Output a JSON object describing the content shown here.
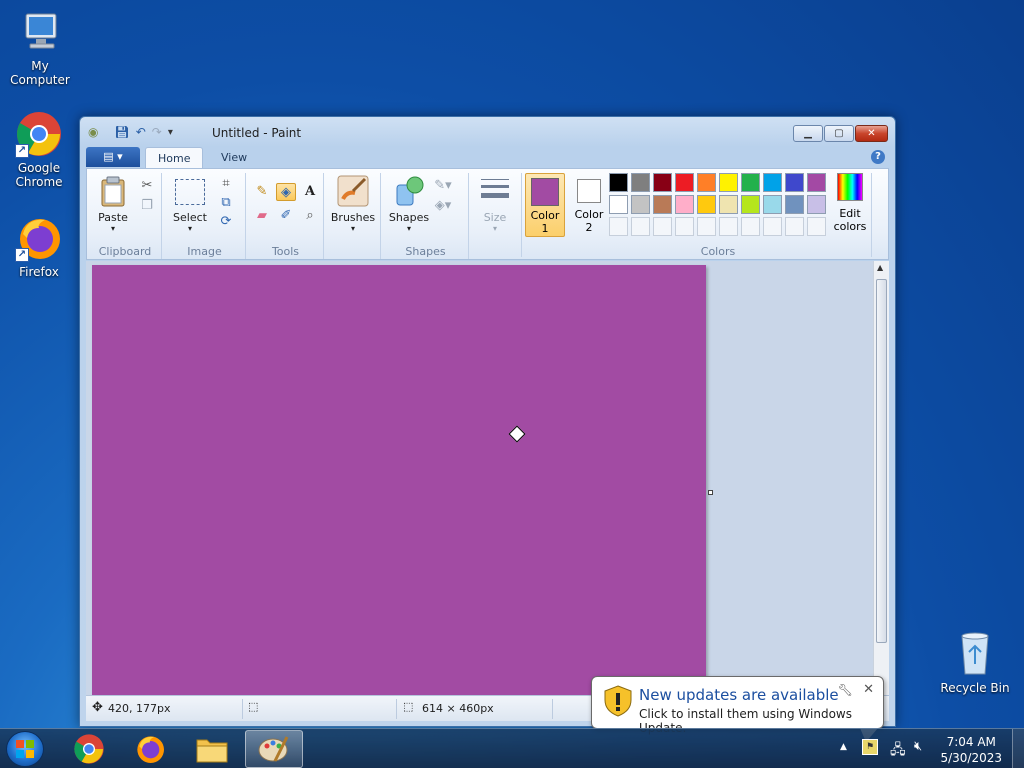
{
  "desktop": {
    "icons": [
      {
        "label": "My Computer",
        "icon": "computer-icon"
      },
      {
        "label": "Google\nChrome",
        "icon": "chrome-icon"
      },
      {
        "label": "Firefox",
        "icon": "firefox-icon"
      },
      {
        "label": "Recycle Bin",
        "icon": "recycle-bin-icon"
      }
    ],
    "chrome_label_1": "Google",
    "chrome_label_2": "Chrome"
  },
  "window": {
    "title": "Untitled - Paint",
    "tabs": {
      "home": "Home",
      "view": "View"
    },
    "help": "?"
  },
  "ribbon": {
    "clipboard": {
      "label": "Clipboard",
      "paste": "Paste"
    },
    "image": {
      "label": "Image",
      "select": "Select"
    },
    "tools": {
      "label": "Tools"
    },
    "brushes": "Brushes",
    "shapes": {
      "label": "Shapes",
      "shapes_btn": "Shapes"
    },
    "size": "Size",
    "color1": {
      "line1": "Color",
      "line2": "1",
      "value": "#a24ba3"
    },
    "color2": {
      "line1": "Color",
      "line2": "2",
      "value": "#ffffff"
    },
    "colors_label": "Colors",
    "edit_colors": {
      "line1": "Edit",
      "line2": "colors"
    },
    "palette_row1": [
      "#000000",
      "#7f7f7f",
      "#880015",
      "#ed1c24",
      "#ff7f27",
      "#fff200",
      "#22b14c",
      "#00a2e8",
      "#3f48cc",
      "#a349a4"
    ],
    "palette_row2": [
      "#ffffff",
      "#c3c3c3",
      "#b97a57",
      "#ffaec9",
      "#ffc90e",
      "#efe4b0",
      "#b5e61d",
      "#99d9ea",
      "#7092be",
      "#c8bfe7"
    ]
  },
  "canvas": {
    "fill": "#a24ba3"
  },
  "status": {
    "cursor_pos": "420, 177px",
    "selection_size": "",
    "image_size": "614 × 460px"
  },
  "notification": {
    "title": "New updates are available",
    "body": "Click to install them using Windows Update."
  },
  "taskbar": {
    "time": "7:04 AM",
    "date": "5/30/2023"
  }
}
